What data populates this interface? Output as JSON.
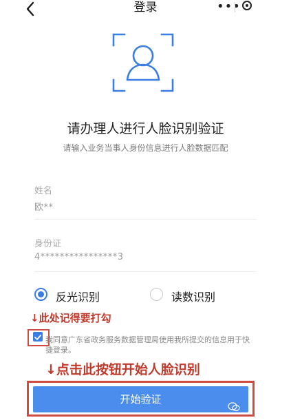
{
  "header": {
    "title": "登录",
    "more_icon": "more-dots-icon",
    "close_icon": "target-close-icon"
  },
  "face": {
    "icon": "face-scan-icon"
  },
  "heading": {
    "title": "请办理人进行人脸识别验证",
    "subtitle": "请输入业务当事人身份信息进行人脸数据匹配"
  },
  "form": {
    "name_label": "姓名",
    "name_value": "欧**",
    "id_label": "身份证",
    "id_value": "4****************3"
  },
  "mode": {
    "options": [
      {
        "label": "反光识别",
        "selected": true
      },
      {
        "label": "读数识别",
        "selected": false
      }
    ]
  },
  "annotations": {
    "checkbox_hint": "↓此处记得要打勾",
    "button_hint": "↓点击此按钮开始人脸识别"
  },
  "agreement": {
    "checked": true,
    "text": "我同意广东省政务服务数据管理局使用我所提交的信息用于快捷登录。"
  },
  "actions": {
    "start_label": "开始验证"
  },
  "colors": {
    "accent": "#3b7de1",
    "annotation": "#c0392b",
    "button": "#4a8ded"
  }
}
